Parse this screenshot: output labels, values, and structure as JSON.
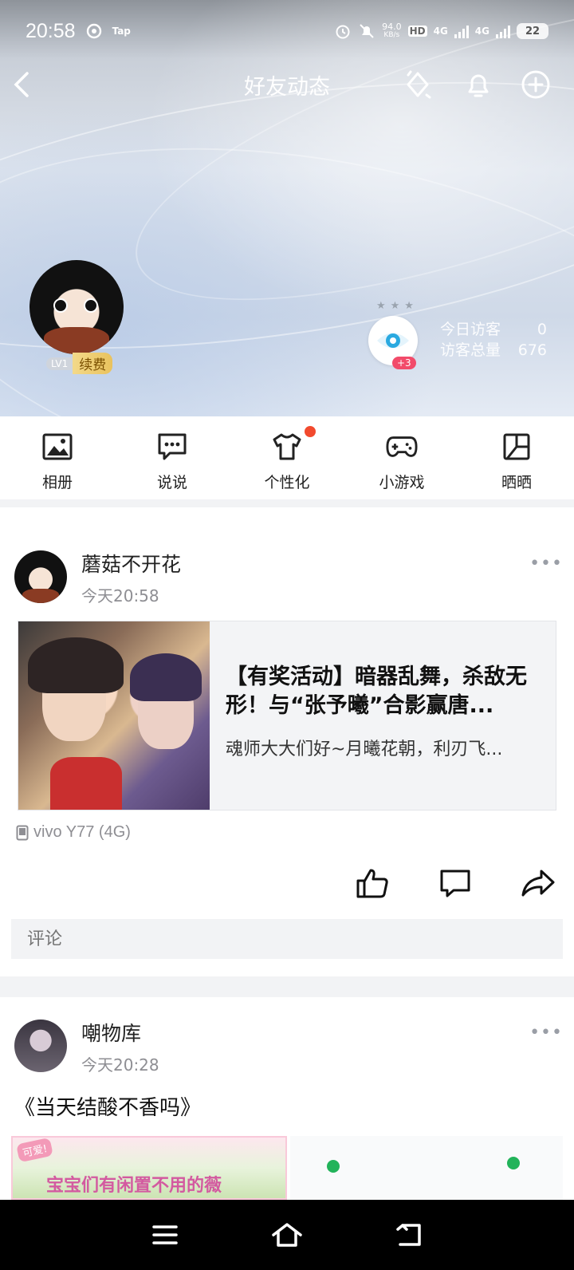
{
  "status_bar": {
    "time": "20:58",
    "app_badge": "Tap",
    "net_speed_top": "94.0",
    "net_speed_unit": "KB/s",
    "hd": "HD",
    "network1": "4G",
    "network2": "4G",
    "battery": "22"
  },
  "nav": {
    "title": "好友动态"
  },
  "profile": {
    "level": "LV1",
    "renew": "续费",
    "visitor_plus": "+3",
    "today_visitors_label": "今日访客",
    "today_visitors_value": "0",
    "total_visitors_label": "访客总量",
    "total_visitors_value": "676"
  },
  "quick_menu": [
    {
      "label": "相册",
      "icon": "photo-icon"
    },
    {
      "label": "说说",
      "icon": "chat-bubble-icon"
    },
    {
      "label": "个性化",
      "icon": "shirt-icon"
    },
    {
      "label": "小游戏",
      "icon": "gamepad-icon"
    },
    {
      "label": "晒晒",
      "icon": "layout-icon"
    }
  ],
  "posts": [
    {
      "author": "蘑菇不开花",
      "time": "今天20:58",
      "share_title": "【有奖活动】暗器乱舞，杀敌无形！与“张予曦”合影赢唐...",
      "share_desc": "魂师大大们好~月曦花朝，利刃飞...",
      "device": "vivo Y77 (4G)",
      "comment_placeholder": "评论"
    },
    {
      "author": "嘲物库",
      "time": "今天20:28",
      "text": "《当天结酸不香吗》",
      "image_text": "宝宝们有闲置不用的薇",
      "image_tag": "可爱!"
    }
  ],
  "colors": {
    "notification_dot": "#f24a2e",
    "visitor_badge": "#f24b6a",
    "renew_gold": "#e9c25d"
  }
}
